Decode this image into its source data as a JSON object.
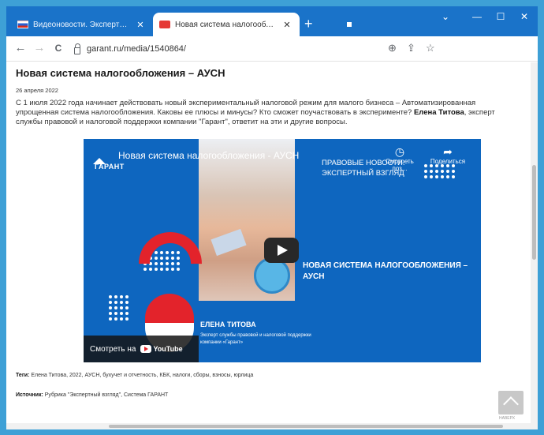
{
  "browser": {
    "tabs": [
      {
        "title": "Видеоновости. Экспертный взгл",
        "active": false,
        "favicon": "flag-icon"
      },
      {
        "title": "Новая система налогообложе",
        "active": true,
        "favicon": "garant-icon"
      }
    ],
    "new_tab": "+",
    "window_controls": {
      "chevron": "⌄",
      "minimize": "—",
      "maximize": "☐",
      "close": "✕"
    },
    "toolbar": {
      "back": "←",
      "forward": "→",
      "reload": "C",
      "url": "garant.ru/media/1540864/",
      "zoom": "⊕",
      "share": "⇪",
      "bookmark": "☆"
    }
  },
  "article": {
    "title": "Новая система налогообложения – АУСН",
    "date": "26 апреля 2022",
    "intro_part1": "С 1 июля 2022 года начинает действовать новый экспериментальный налоговой режим для малого бизнеса – Автоматизированная упрощенная система налогообложения. Каковы ее плюсы и минусы? Кто сможет поучаствовать в эксперименте? ",
    "intro_bold": "Елена Титова",
    "intro_part2": ", эксперт службы правовой и налоговой поддержки компании \"Гарант\", ответит на эти и другие вопросы.",
    "video": {
      "logo_text": "ГАРАНТ",
      "title": "Новая система налогообложения - АУСН",
      "news_line1": "ПРАВОВЫЕ НОВОСТИ.",
      "news_line2": "ЭКСПЕРТНЫЙ ВЗГЛЯД",
      "watch_later": "Смотреть поз...",
      "share": "Поделиться",
      "heading": "НОВАЯ СИСТЕМА НАЛОГООБЛОЖЕНИЯ – АУСН",
      "speaker": "ЕЛЕНА ТИТОВА",
      "speaker_role": "Эксперт службы правовой и налоговой поддержки компании «Гарант»",
      "watch_on": "Смотреть на",
      "youtube": "YouTube",
      "accent_red": "#e3232b",
      "background": "#0e66bf"
    },
    "tags_label": "Теги:",
    "tags": "Елена Титова, 2022, АУСН, бухучет и отчетность, КБК, налоги, сборы, взносы, юрлица",
    "source_label": "Источник:",
    "source": "Рубрика \"Экспертный взгляд\", Система ГАРАНТ",
    "scroll_top_label": "НАВЕРХ"
  }
}
